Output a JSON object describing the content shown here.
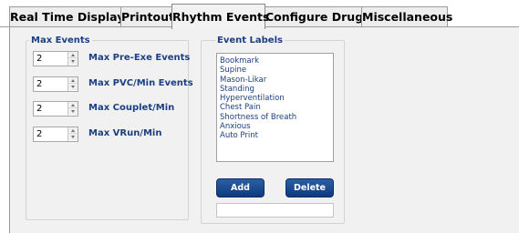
{
  "tabs": [
    {
      "label": "Real Time Display",
      "active": false
    },
    {
      "label": "Printout",
      "active": false
    },
    {
      "label": "Rhythm Events",
      "active": true
    },
    {
      "label": "Configure Drugs",
      "active": false
    },
    {
      "label": "Miscellaneous",
      "active": false
    }
  ],
  "max_events": {
    "legend": "Max Events",
    "fields": [
      {
        "value": "2",
        "label": "Max Pre-Exe Events"
      },
      {
        "value": "2",
        "label": "Max PVC/Min Events"
      },
      {
        "value": "2",
        "label": "Max Couplet/Min"
      },
      {
        "value": "2",
        "label": "Max VRun/Min"
      }
    ]
  },
  "event_labels": {
    "legend": "Event Labels",
    "items": [
      "Bookmark",
      "Supine",
      "Mason-Likar",
      "Standing",
      "Hyperventilation",
      "Chest Pain",
      "Shortness of Breath",
      "Anxious",
      "Auto Print"
    ],
    "add_label": "Add",
    "delete_label": "Delete",
    "new_label_value": ""
  },
  "colors": {
    "label_blue": "#1b3f82",
    "button_blue": "#1a4a8f",
    "panel_bg": "#f1f1f1"
  }
}
